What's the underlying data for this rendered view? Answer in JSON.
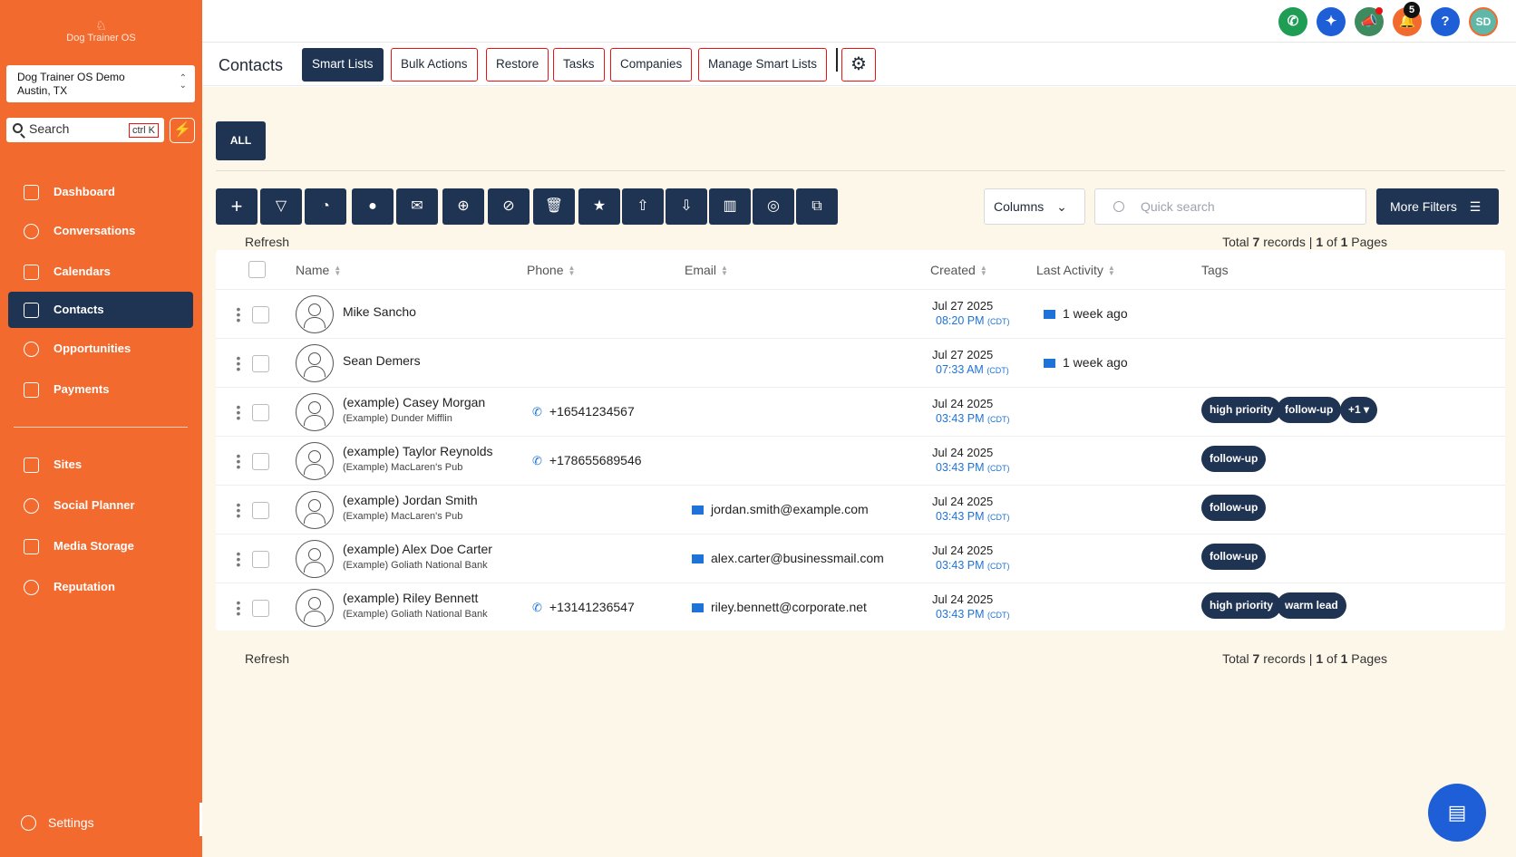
{
  "brand": {
    "name": "Dog Trainer OS"
  },
  "location": {
    "name": "Dog Trainer OS Demo",
    "city": "Austin, TX"
  },
  "search": {
    "label": "Search",
    "shortcut": "ctrl K"
  },
  "nav": [
    {
      "label": "Dashboard",
      "icon": "dashboard-icon"
    },
    {
      "label": "Conversations",
      "icon": "chat-icon"
    },
    {
      "label": "Calendars",
      "icon": "calendar-icon"
    },
    {
      "label": "Contacts",
      "icon": "contacts-icon",
      "active": true
    },
    {
      "label": "Opportunities",
      "icon": "opportunities-icon"
    },
    {
      "label": "Payments",
      "icon": "payments-icon"
    },
    {
      "label": "Sites",
      "icon": "sites-icon"
    },
    {
      "label": "Social Planner",
      "icon": "social-icon"
    },
    {
      "label": "Media Storage",
      "icon": "media-icon"
    },
    {
      "label": "Reputation",
      "icon": "star-icon"
    },
    {
      "label": "Settings",
      "icon": "gear-icon"
    }
  ],
  "topbar": {
    "notification_count": "5",
    "avatar_initials": "SD",
    "help": "?"
  },
  "header": {
    "title": "Contacts",
    "tabs": [
      "Smart Lists",
      "Bulk Actions",
      "Restore",
      "Tasks",
      "Companies",
      "Manage Smart Lists"
    ]
  },
  "filter": {
    "all_label": "ALL"
  },
  "toolbar": {
    "columns_label": "Columns",
    "quick_search_placeholder": "Quick search",
    "more_filters_label": "More Filters"
  },
  "table": {
    "refresh_label": "Refresh",
    "total_prefix": "Total",
    "total_records": "7",
    "records_word": "records |",
    "page_current": "1",
    "of_word": "of",
    "page_total": "1",
    "pages_word": "Pages",
    "headers": {
      "name": "Name",
      "phone": "Phone",
      "email": "Email",
      "created": "Created",
      "last_activity": "Last Activity",
      "tags": "Tags"
    },
    "rows": [
      {
        "name": "Mike Sancho",
        "company": "",
        "phone": "",
        "email": "",
        "created_date": "Jul 27 2025",
        "created_time": "08:20 PM",
        "tz": "(CDT)",
        "activity": "1 week ago",
        "tags": []
      },
      {
        "name": "Sean Demers",
        "company": "",
        "phone": "",
        "email": "",
        "created_date": "Jul 27 2025",
        "created_time": "07:33 AM",
        "tz": "(CDT)",
        "activity": "1 week ago",
        "tags": []
      },
      {
        "name": "(example) Casey Morgan",
        "company": "(Example) Dunder Mifflin",
        "phone": "+16541234567",
        "email": "",
        "created_date": "Jul 24 2025",
        "created_time": "03:43 PM",
        "tz": "(CDT)",
        "activity": "",
        "tags": [
          "high priority",
          "follow-up",
          "+1 ▾"
        ]
      },
      {
        "name": "(example) Taylor Reynolds",
        "company": "(Example) MacLaren's Pub",
        "phone": "+178655689546",
        "email": "",
        "created_date": "Jul 24 2025",
        "created_time": "03:43 PM",
        "tz": "(CDT)",
        "activity": "",
        "tags": [
          "follow-up"
        ]
      },
      {
        "name": "(example) Jordan Smith",
        "company": "(Example) MacLaren's Pub",
        "phone": "",
        "email": "jordan.smith@example.com",
        "created_date": "Jul 24 2025",
        "created_time": "03:43 PM",
        "tz": "(CDT)",
        "activity": "",
        "tags": [
          "follow-up"
        ]
      },
      {
        "name": "(example) Alex Doe Carter",
        "company": "(Example) Goliath National Bank",
        "phone": "",
        "email": "alex.carter@businessmail.com",
        "created_date": "Jul 24 2025",
        "created_time": "03:43 PM",
        "tz": "(CDT)",
        "activity": "",
        "tags": [
          "follow-up"
        ]
      },
      {
        "name": "(example) Riley Bennett",
        "company": "(Example) Goliath National Bank",
        "phone": "+13141236547",
        "email": "riley.bennett@corporate.net",
        "created_date": "Jul 24 2025",
        "created_time": "03:43 PM",
        "tz": "(CDT)",
        "activity": "",
        "tags": [
          "high priority",
          "warm lead"
        ]
      }
    ]
  },
  "colors": {
    "sidebar": "#f26a2e",
    "navy": "#1f3352",
    "accent_blue": "#1e73d8",
    "background": "#fdf7e9"
  }
}
